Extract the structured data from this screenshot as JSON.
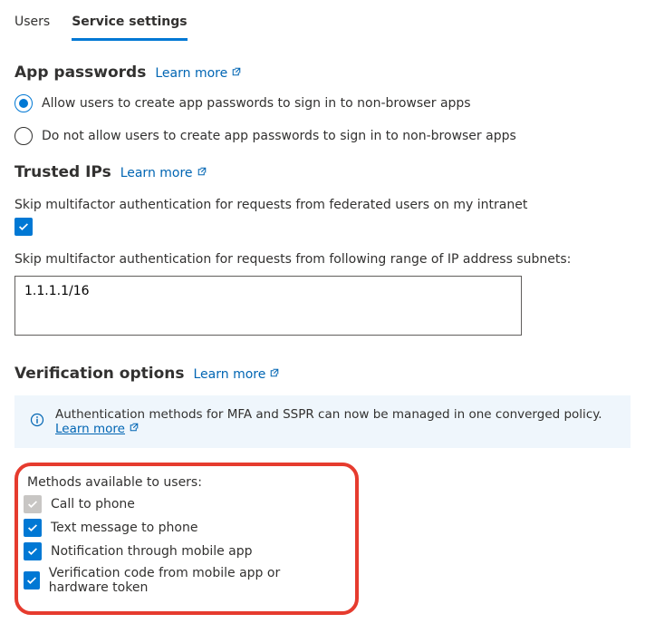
{
  "tabs": {
    "users": "Users",
    "service_settings": "Service settings"
  },
  "sections": {
    "app_passwords": {
      "title": "App passwords",
      "learn_more": "Learn more",
      "opt_allow": "Allow users to create app passwords to sign in to non-browser apps",
      "opt_deny": "Do not allow users to create app passwords to sign in to non-browser apps"
    },
    "trusted_ips": {
      "title": "Trusted IPs",
      "learn_more": "Learn more",
      "skip_federated": "Skip multifactor authentication for requests from federated users on my intranet",
      "skip_subnets_label": "Skip multifactor authentication for requests from following range of IP address subnets:",
      "subnets_value": "1.1.1.1/16"
    },
    "verification": {
      "title": "Verification options",
      "learn_more": "Learn more",
      "banner_text": "Authentication methods for MFA and SSPR can now be managed in one converged policy.",
      "banner_link": "Learn more",
      "methods_head": "Methods available to users:",
      "method_call": "Call to phone",
      "method_text": "Text message to phone",
      "method_notify": "Notification through mobile app",
      "method_code": "Verification code from mobile app or hardware token"
    }
  }
}
